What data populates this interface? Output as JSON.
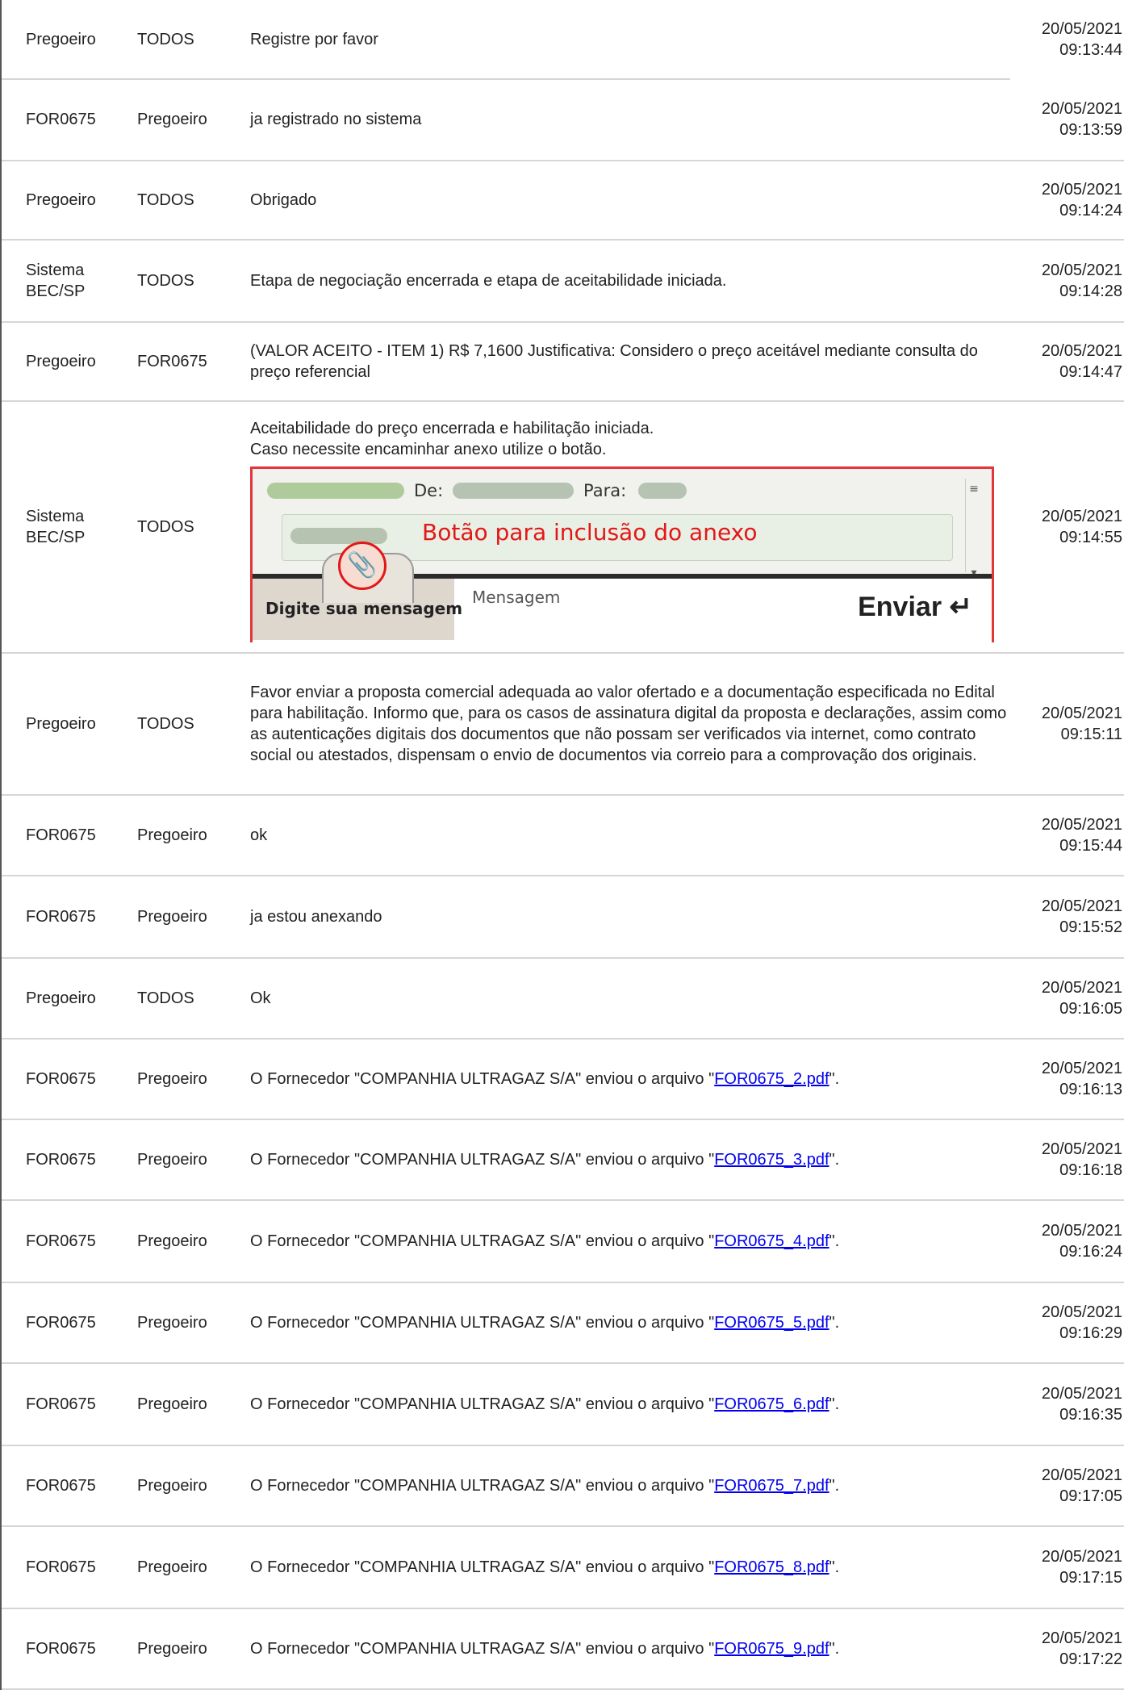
{
  "rows": [
    {
      "from": "Pregoeiro",
      "to": "TODOS",
      "msg": "Registre por favor",
      "date": "20/05/2021",
      "time": "09:13:44"
    },
    {
      "from": "FOR0675",
      "to": "Pregoeiro",
      "msg": "ja registrado no sistema",
      "date": "20/05/2021",
      "time": "09:13:59"
    },
    {
      "from": "Pregoeiro",
      "to": "TODOS",
      "msg": "Obrigado",
      "date": "20/05/2021",
      "time": "09:14:24"
    },
    {
      "from": "Sistema BEC/SP",
      "to": "TODOS",
      "msg": "Etapa de negociação encerrada e etapa de aceitabilidade iniciada.",
      "date": "20/05/2021",
      "time": "09:14:28"
    },
    {
      "from": "Pregoeiro",
      "to": "FOR0675",
      "msg": "(VALOR ACEITO - ITEM 1) R$ 7,1600 Justificativa: Considero o preço aceitável mediante consulta do preço referencial",
      "date": "20/05/2021",
      "time": "09:14:47"
    },
    {
      "from": "Sistema BEC/SP",
      "to": "TODOS",
      "msg": "",
      "msg_line1": "Aceitabilidade do preço encerrada e habilitação iniciada.",
      "msg_line2": "Caso necessite encaminhar anexo utilize o botão.",
      "date": "20/05/2021",
      "time": "09:14:55"
    },
    {
      "from": "Pregoeiro",
      "to": "TODOS",
      "msg": "Favor enviar a proposta comercial adequada ao valor ofertado e a documentação especificada no Edital para habilitação. Informo que, para os casos de assinatura digital da proposta e declarações, assim como as autenticações digitais dos documentos que não possam ser verificados via internet, como contrato social ou atestados, dispensam o envio de documentos via correio para a comprovação dos originais.",
      "date": "20/05/2021",
      "time": "09:15:11"
    },
    {
      "from": "FOR0675",
      "to": "Pregoeiro",
      "msg": "ok",
      "date": "20/05/2021",
      "time": "09:15:44"
    },
    {
      "from": "FOR0675",
      "to": "Pregoeiro",
      "msg": "ja estou anexando",
      "date": "20/05/2021",
      "time": "09:15:52"
    },
    {
      "from": "Pregoeiro",
      "to": "TODOS",
      "msg": "Ok",
      "date": "20/05/2021",
      "time": "09:16:05"
    },
    {
      "from": "FOR0675",
      "to": "Pregoeiro",
      "msg_prefix": "O Fornecedor \"COMPANHIA ULTRAGAZ S/A\" enviou o arquivo \"",
      "file": "FOR0675_2.pdf",
      "msg_suffix": "\".",
      "date": "20/05/2021",
      "time": "09:16:13"
    },
    {
      "from": "FOR0675",
      "to": "Pregoeiro",
      "msg_prefix": "O Fornecedor \"COMPANHIA ULTRAGAZ S/A\" enviou o arquivo \"",
      "file": "FOR0675_3.pdf",
      "msg_suffix": "\".",
      "date": "20/05/2021",
      "time": "09:16:18"
    },
    {
      "from": "FOR0675",
      "to": "Pregoeiro",
      "msg_prefix": "O Fornecedor \"COMPANHIA ULTRAGAZ S/A\" enviou o arquivo \"",
      "file": "FOR0675_4.pdf",
      "msg_suffix": "\".",
      "date": "20/05/2021",
      "time": "09:16:24"
    },
    {
      "from": "FOR0675",
      "to": "Pregoeiro",
      "msg_prefix": "O Fornecedor \"COMPANHIA ULTRAGAZ S/A\" enviou o arquivo \"",
      "file": "FOR0675_5.pdf",
      "msg_suffix": "\".",
      "date": "20/05/2021",
      "time": "09:16:29"
    },
    {
      "from": "FOR0675",
      "to": "Pregoeiro",
      "msg_prefix": "O Fornecedor \"COMPANHIA ULTRAGAZ S/A\" enviou o arquivo \"",
      "file": "FOR0675_6.pdf",
      "msg_suffix": "\".",
      "date": "20/05/2021",
      "time": "09:16:35"
    },
    {
      "from": "FOR0675",
      "to": "Pregoeiro",
      "msg_prefix": "O Fornecedor \"COMPANHIA ULTRAGAZ S/A\" enviou o arquivo \"",
      "file": "FOR0675_7.pdf",
      "msg_suffix": "\".",
      "date": "20/05/2021",
      "time": "09:17:05"
    },
    {
      "from": "FOR0675",
      "to": "Pregoeiro",
      "msg_prefix": "O Fornecedor \"COMPANHIA ULTRAGAZ S/A\" enviou o arquivo \"",
      "file": "FOR0675_8.pdf",
      "msg_suffix": "\".",
      "date": "20/05/2021",
      "time": "09:17:15"
    },
    {
      "from": "FOR0675",
      "to": "Pregoeiro",
      "msg_prefix": "O Fornecedor \"COMPANHIA ULTRAGAZ S/A\" enviou o arquivo \"",
      "file": "FOR0675_9.pdf",
      "msg_suffix": "\".",
      "date": "20/05/2021",
      "time": "09:17:22"
    }
  ],
  "attachment_screenshot": {
    "de_label": "De:",
    "para_label": "Para:",
    "annotation": "Botão para inclusão do anexo",
    "typing_label": "Digite sua mensagem",
    "message_placeholder": "Mensagem",
    "send_label": "Enviar ↵",
    "clip_icon": "paperclip-icon",
    "highlight_color": "#e21818"
  },
  "colors": {
    "link": "#0000ee",
    "divider": "#d6d6d6"
  }
}
